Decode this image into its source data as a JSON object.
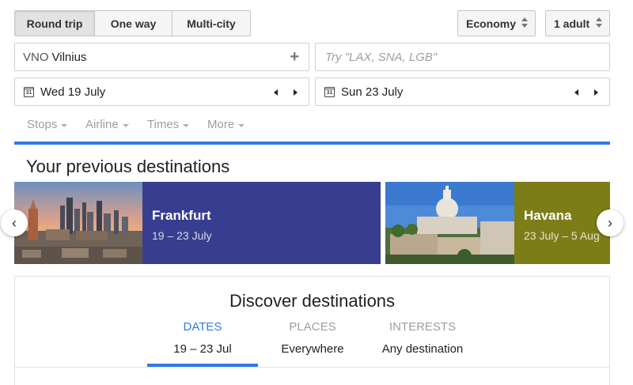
{
  "trip_type": {
    "options": [
      "Round trip",
      "One way",
      "Multi-city"
    ],
    "selected": "Round trip"
  },
  "cabin_class": {
    "value": "Economy"
  },
  "passengers": {
    "value": "1 adult"
  },
  "origin": {
    "code": "VNO",
    "city": "Vilnius"
  },
  "destination": {
    "placeholder": "Try \"LAX, SNA, LGB\""
  },
  "depart": {
    "calendar_day": "31",
    "date": "Wed 19 July"
  },
  "return": {
    "calendar_day": "31",
    "date": "Sun 23 July"
  },
  "filters": [
    "Stops",
    "Airline",
    "Times",
    "More"
  ],
  "previous_destinations": {
    "title": "Your previous destinations",
    "cards": [
      {
        "city": "Frankfurt",
        "dates": "19 – 23 July",
        "color": "#383e8f"
      },
      {
        "city": "Havana",
        "dates": "23 July – 5 Aug",
        "color": "#7c7d17"
      }
    ]
  },
  "discover": {
    "title": "Discover destinations",
    "tabs": [
      {
        "label": "DATES",
        "value": "19 – 23 Jul"
      },
      {
        "label": "PLACES",
        "value": "Everywhere"
      },
      {
        "label": "INTERESTS",
        "value": "Any destination"
      }
    ],
    "active_tab": "DATES"
  },
  "colors": {
    "accent_blue": "#2f7be6",
    "frankfurt_card": "#383e8f",
    "havana_card": "#7c7d17"
  }
}
